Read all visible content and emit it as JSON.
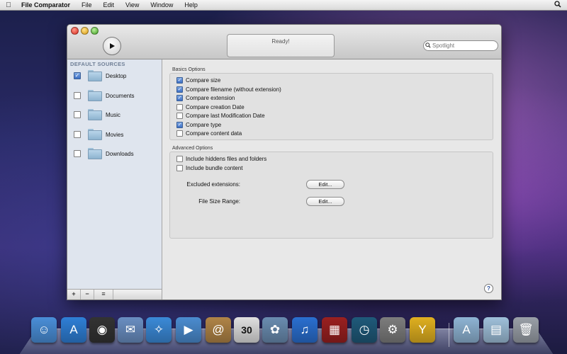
{
  "menubar": {
    "apple": "",
    "app_name": "File Comparator",
    "menus": [
      "File",
      "Edit",
      "View",
      "Window",
      "Help"
    ],
    "spotlight_icon": "spotlight-icon"
  },
  "toolbar": {
    "status": "Ready!",
    "search_placeholder": "Spotlight"
  },
  "sidebar": {
    "header": "DEFAULT SOURCES",
    "items": [
      {
        "label": "Desktop",
        "checked": true
      },
      {
        "label": "Documents",
        "checked": false
      },
      {
        "label": "Music",
        "checked": false
      },
      {
        "label": "Movies",
        "checked": false
      },
      {
        "label": "Downloads",
        "checked": false
      }
    ],
    "footer": {
      "add": "+",
      "remove": "−",
      "action": "≡"
    }
  },
  "basics": {
    "title": "Basics Options",
    "options": [
      {
        "label": "Compare size",
        "checked": true
      },
      {
        "label": "Compare filename (without extension)",
        "checked": true
      },
      {
        "label": "Compare extension",
        "checked": true
      },
      {
        "label": "Compare creation Date",
        "checked": false
      },
      {
        "label": "Compare last Modification Date",
        "checked": false
      },
      {
        "label": "Compare type",
        "checked": true
      },
      {
        "label": "Compare content data",
        "checked": false
      }
    ]
  },
  "advanced": {
    "title": "Advanced Options",
    "options": [
      {
        "label": "Include hiddens files and folders",
        "checked": false
      },
      {
        "label": "Include bundle content",
        "checked": false
      }
    ],
    "excluded_label": "Excluded extensions:",
    "excluded_button": "Edit...",
    "size_label": "File Size Range:",
    "size_button": "Edit..."
  },
  "help": "?",
  "dock": [
    {
      "name": "finder-icon",
      "glyph": "☺",
      "color": "#4a8fd8"
    },
    {
      "name": "app-store-icon",
      "glyph": "A",
      "color": "#2f7fd6"
    },
    {
      "name": "dashboard-icon",
      "glyph": "◉",
      "color": "#333"
    },
    {
      "name": "mail-icon",
      "glyph": "✉",
      "color": "#6a8fc2"
    },
    {
      "name": "safari-icon",
      "glyph": "✧",
      "color": "#3b8ad8"
    },
    {
      "name": "facetime-icon",
      "glyph": "▶",
      "color": "#4b8cd0"
    },
    {
      "name": "address-book-icon",
      "glyph": "@",
      "color": "#b08447"
    },
    {
      "name": "ical-icon",
      "glyph": "30",
      "color": "#e0e0e0"
    },
    {
      "name": "iphoto-icon",
      "glyph": "✿",
      "color": "#6a8cb0"
    },
    {
      "name": "itunes-icon",
      "glyph": "♫",
      "color": "#2a6fd0"
    },
    {
      "name": "photo-booth-icon",
      "glyph": "▦",
      "color": "#9a2020"
    },
    {
      "name": "time-machine-icon",
      "glyph": "◷",
      "color": "#1f5a7a"
    },
    {
      "name": "system-preferences-icon",
      "glyph": "⚙",
      "color": "#7d7d7d"
    },
    {
      "name": "file-comparator-icon",
      "glyph": "Y",
      "color": "#e0b020"
    },
    {
      "name": "applications-folder-icon",
      "glyph": "A",
      "color": "#8fb4d4"
    },
    {
      "name": "documents-folder-icon",
      "glyph": "▤",
      "color": "#9fc0da"
    },
    {
      "name": "trash-icon",
      "glyph": "🗑",
      "color": "#9aa0a8"
    }
  ]
}
